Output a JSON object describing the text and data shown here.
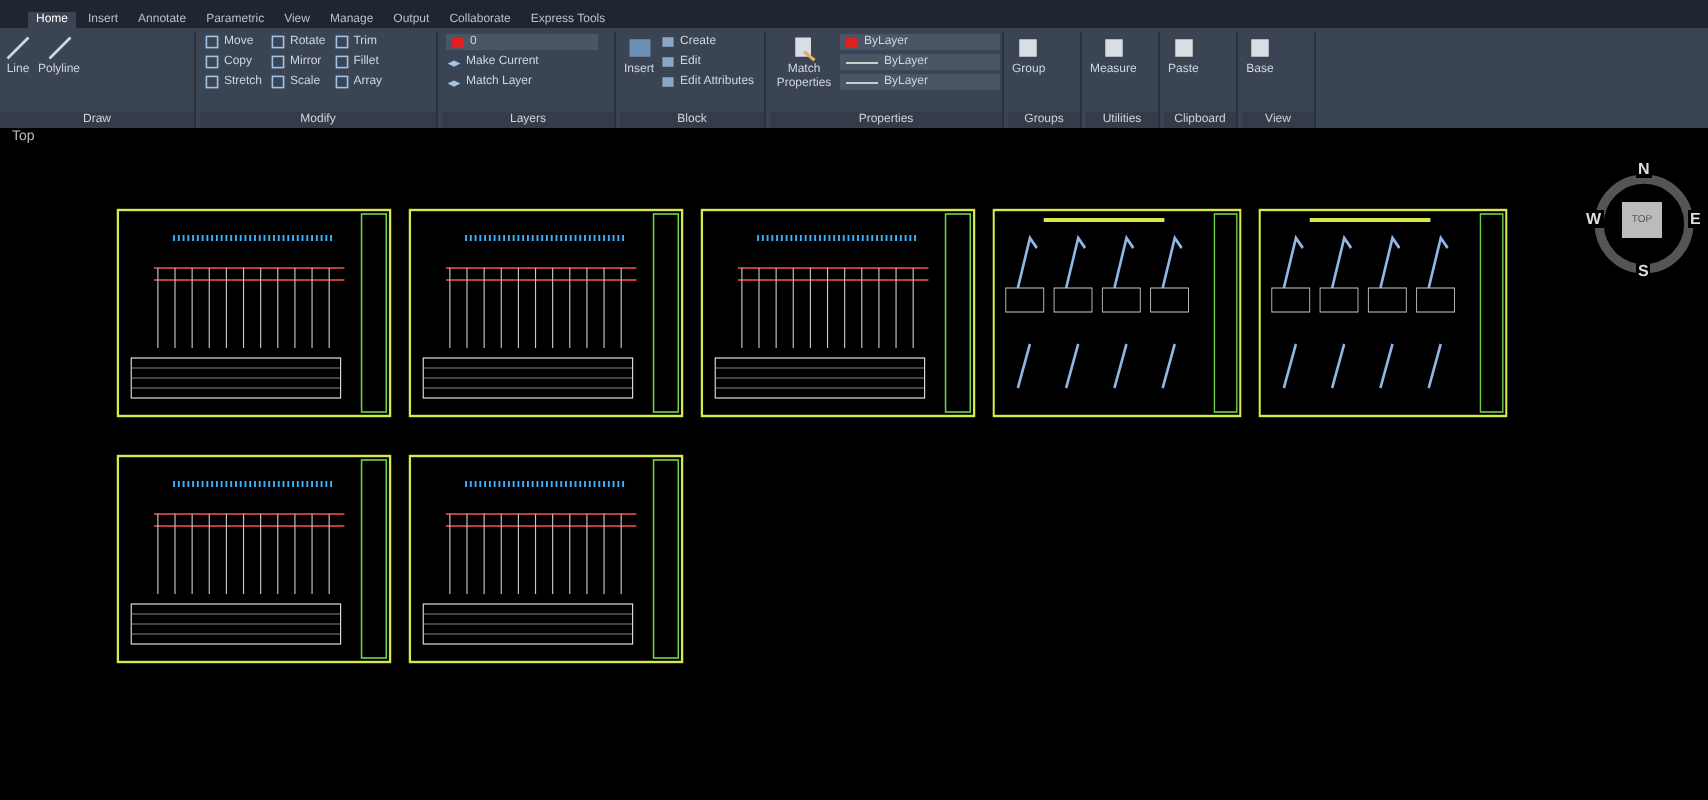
{
  "tabs": [
    {
      "label": "Home",
      "selected": true
    },
    {
      "label": "Insert",
      "selected": false
    },
    {
      "label": "Annotate",
      "selected": false
    },
    {
      "label": "Parametric",
      "selected": false
    },
    {
      "label": "View",
      "selected": false
    },
    {
      "label": "Manage",
      "selected": false
    },
    {
      "label": "Output",
      "selected": false
    },
    {
      "label": "Collaborate",
      "selected": false
    },
    {
      "label": "Express Tools",
      "selected": false
    }
  ],
  "panels": [
    {
      "kind": "draw",
      "title": "Draw",
      "tools": [
        "Line",
        "Polyline"
      ]
    },
    {
      "kind": "modify",
      "title": "Modify",
      "tools": [
        "Move",
        "Rotate",
        "Trim",
        "Copy",
        "Mirror",
        "Fillet",
        "Stretch",
        "Scale",
        "Array"
      ]
    },
    {
      "kind": "layers",
      "title": "Layers",
      "layer": "0",
      "tools": [
        "Make Current",
        "Match Layer"
      ]
    },
    {
      "kind": "block",
      "title": "Block",
      "big": "Insert",
      "tools": [
        "Create",
        "Edit",
        "Edit Attributes"
      ]
    },
    {
      "kind": "properties",
      "title": "Properties",
      "big": "Match Properties",
      "tools": [
        "ByLayer",
        "ByLayer",
        "ByLayer"
      ]
    },
    {
      "kind": "big",
      "title": "Groups",
      "big": "Group"
    },
    {
      "kind": "big",
      "title": "Utilities",
      "big": "Measure"
    },
    {
      "kind": "big",
      "title": "Clipboard",
      "big": "Paste"
    },
    {
      "kind": "big",
      "title": "View",
      "big": "Base"
    }
  ],
  "viewport": {
    "label": "Top"
  },
  "viewcube": {
    "north": "N",
    "west": "W",
    "east": "E",
    "south": "S",
    "face": "TOP"
  },
  "sheet_rows": [
    {
      "sheets": [
        {
          "kind": "elevation"
        },
        {
          "kind": "elevation"
        },
        {
          "kind": "elevation"
        },
        {
          "kind": "details"
        },
        {
          "kind": "details"
        }
      ]
    },
    {
      "sheets": [
        {
          "kind": "elevation"
        },
        {
          "kind": "elevation"
        }
      ]
    }
  ]
}
